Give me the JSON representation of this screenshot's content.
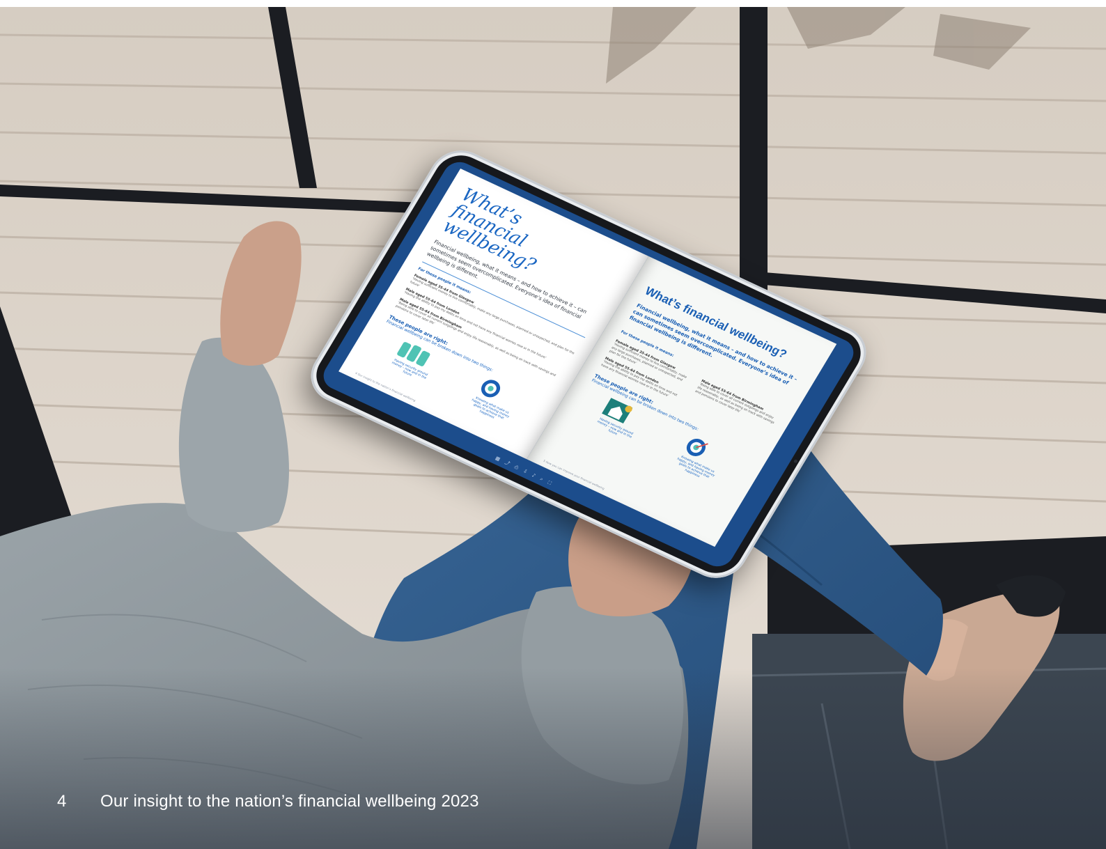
{
  "footer": {
    "page_number": "4",
    "caption": "Our insight to the nation’s financial wellbeing 2023"
  },
  "tablet_screen": {
    "left_page": {
      "title": "What’s financial wellbeing?",
      "intro": "Financial wellbeing, what it means – and how to achieve it – can sometimes seem overcomplicated. Everyone’s idea of financial wellbeing is different.",
      "subheading": "For these people it means:",
      "people": [
        {
          "who": "Female aged 35-44 from Glasgow",
          "quote": "‘Having sufficient money to live comfortably, make any large purchases, planned or unexpected, and plan for the future’"
        },
        {
          "who": "Male aged 55-64 from London",
          "quote": "‘Having the ability to pay my debts on time and not have any financial worries now or in the future’"
        },
        {
          "who": "Male aged 55-64 from Birmingham",
          "quote": "‘Being able to cover all current outgoings and enjoy life reasonably, as well as being on track with savings and pensions to cover later life’"
        }
      ],
      "right_heading": "These people are right:",
      "right_sub": "Financial wellbeing can be broken down into two things:",
      "caption_1": "Having security around money – now and in the future",
      "caption_2": "Knowing what make us happy, and having money goals to achieve that happiness",
      "footer": "4   Our insight to the nation’s financial wellbeing"
    },
    "right_page": {
      "title": "What’s financial wellbeing?",
      "intro": "Financial wellbeing, what it means – and how to achieve it – can sometimes seem overcomplicated. Everyone’s idea of financial wellbeing is different.",
      "subheading": "For these people it means:",
      "people": [
        {
          "who": "Female aged 35-44 from Glasgow",
          "quote": "‘Having sufficient money to live comfortably, make any large purchases, planned or unexpected, and plan for the future’"
        },
        {
          "who": "Male aged 55-64 from London",
          "quote": "‘Having the ability to pay my debts on time and not have any financial worries now or in the future’"
        },
        {
          "who": "Male aged 55-64 from Birmingham",
          "quote": "‘Being able to cover all current outgoings and enjoy life reasonably, as well as being on track with savings and pensions to cover later life’"
        }
      ],
      "right_heading": "These people are right:",
      "right_sub": "Financial wellbeing can be broken down into two things:",
      "caption_1": "Having security around money – now and in the future",
      "caption_2": "Knowing what make us happy, and having money goals to achieve that happiness",
      "footer": "5   How you can improve your financial wellbeing"
    },
    "toolbar_icons": [
      "grid-icon",
      "share-icon",
      "print-icon",
      "download-icon",
      "sound-icon",
      "zoom-icon",
      "fullscreen-icon"
    ]
  },
  "colors": {
    "brand_blue": "#1a5fb4",
    "tablet_blue": "#1c4d8c",
    "window_frame": "#1b1d22",
    "deck": "#d9d0c6",
    "jeans": "#2d5a8a",
    "sweater": "#8e979c"
  }
}
